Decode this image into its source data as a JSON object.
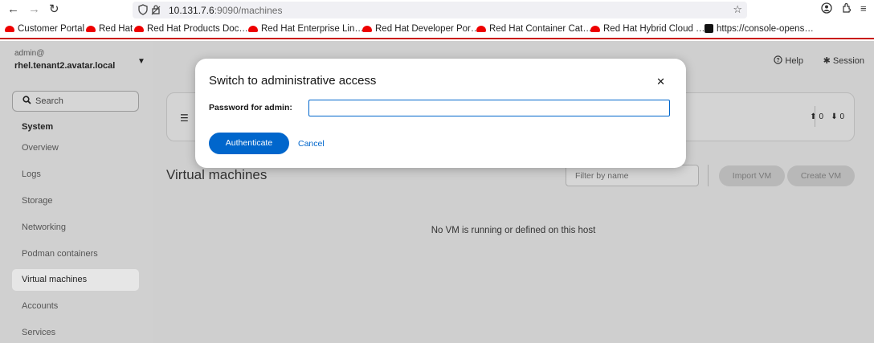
{
  "browser": {
    "nav": {
      "back": "←",
      "forward": "→",
      "reload": "↻"
    },
    "url_host": "10.131.7.6",
    "url_rest": ":9090/machines",
    "icons": {
      "shield": "shield-icon",
      "lock": "lock-icon",
      "star": "star-icon",
      "account": "account-icon",
      "extensions": "extensions-icon",
      "menu": "menu-icon"
    }
  },
  "bookmarks": [
    {
      "label": "Customer Portal"
    },
    {
      "label": "Red Hat"
    },
    {
      "label": "Red Hat Products Doc…"
    },
    {
      "label": "Red Hat Enterprise Lin…"
    },
    {
      "label": "Red Hat Developer Por…"
    },
    {
      "label": "Red Hat Container Cat…"
    },
    {
      "label": "Red Hat Hybrid Cloud …"
    },
    {
      "label": "https://console-opens…"
    }
  ],
  "host": {
    "user": "admin@",
    "name": "rhel.tenant2.avatar.local"
  },
  "sidebar": {
    "search_label": "Search",
    "heading": "System",
    "items": [
      {
        "label": "Overview"
      },
      {
        "label": "Logs"
      },
      {
        "label": "Storage"
      },
      {
        "label": "Networking"
      },
      {
        "label": "Podman containers"
      },
      {
        "label": "Virtual machines",
        "active": true
      },
      {
        "label": "Accounts"
      },
      {
        "label": "Services"
      }
    ]
  },
  "topbar": {
    "help": "Help",
    "session": "Session"
  },
  "card": {
    "up_count": "0",
    "down_count": "0"
  },
  "main": {
    "title": "Virtual machines",
    "filter_placeholder": "Filter by name",
    "import_label": "Import VM",
    "create_label": "Create VM",
    "empty_text": "No VM is running or defined on this host"
  },
  "modal": {
    "title": "Switch to administrative access",
    "password_label": "Password for admin:",
    "password_value": "",
    "authenticate_label": "Authenticate",
    "cancel_label": "Cancel"
  },
  "colors": {
    "primary": "#0066cc",
    "redhat_red": "#ee0000",
    "accent_bar": "#c9190b"
  }
}
